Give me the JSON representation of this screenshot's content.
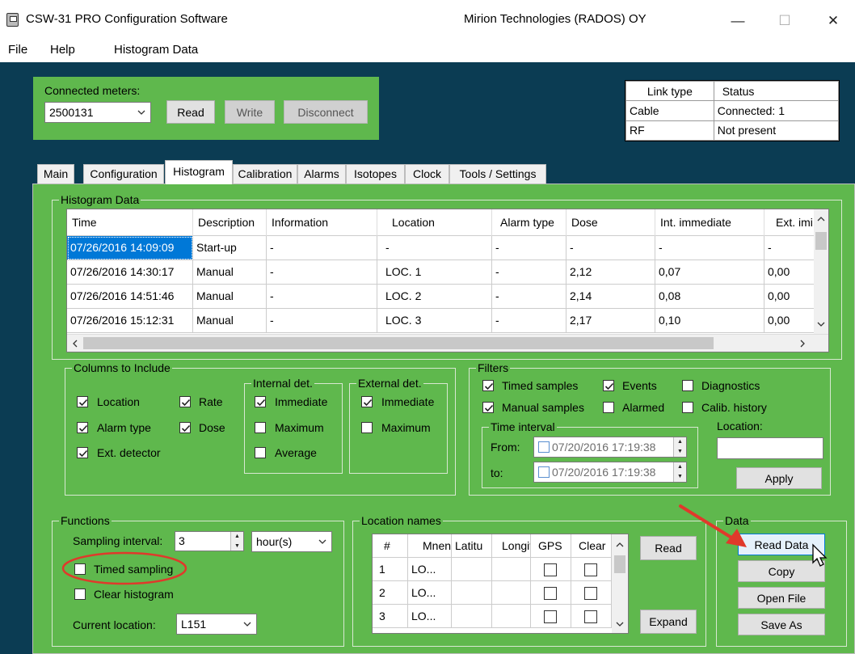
{
  "window": {
    "title": "CSW-31 PRO Configuration Software",
    "company": "Mirion Technologies (RADOS) OY",
    "minimize": "—",
    "maximize": "☐",
    "close": "✕"
  },
  "menu": [
    "File",
    "Help",
    "Histogram Data"
  ],
  "connection": {
    "label": "Connected meters:",
    "selected_meter": "2500131",
    "read": "Read",
    "write": "Write",
    "disconnect": "Disconnect"
  },
  "link_table": {
    "headers": [
      "Link type",
      "Status"
    ],
    "rows": [
      [
        "Cable",
        "Connected: 1"
      ],
      [
        "RF",
        "Not present"
      ]
    ]
  },
  "tabs": [
    "Main",
    "Configuration",
    "Histogram",
    "Calibration",
    "Alarms",
    "Isotopes",
    "Clock",
    "Tools / Settings"
  ],
  "active_tab": "Histogram",
  "histogram": {
    "group_title": "Histogram Data",
    "columns": [
      "Time",
      "Description",
      "Information",
      "Location",
      "Alarm type",
      "Dose",
      "Int. immediate",
      "Ext. imi"
    ],
    "rows": [
      [
        "07/26/2016 14:09:09",
        "Start-up",
        "-",
        "-",
        "-",
        "-",
        "-",
        "-"
      ],
      [
        "07/26/2016 14:30:17",
        "Manual",
        "-",
        "LOC. 1",
        "-",
        "2,12",
        "0,07",
        "0,00"
      ],
      [
        "07/26/2016 14:51:46",
        "Manual",
        "-",
        "LOC. 2",
        "-",
        "2,14",
        "0,08",
        "0,00"
      ],
      [
        "07/26/2016 15:12:31",
        "Manual",
        "-",
        "LOC. 3",
        "-",
        "2,17",
        "0,10",
        "0,00"
      ]
    ]
  },
  "columns_to_include": {
    "title": "Columns to Include",
    "location": "Location",
    "rate": "Rate",
    "alarm_type": "Alarm type",
    "dose": "Dose",
    "ext_detector": "Ext. detector",
    "internal": {
      "title": "Internal det.",
      "immediate": "Immediate",
      "maximum": "Maximum",
      "average": "Average"
    },
    "external": {
      "title": "External det.",
      "immediate": "Immediate",
      "maximum": "Maximum"
    }
  },
  "filters": {
    "title": "Filters",
    "timed_samples": "Timed samples",
    "events": "Events",
    "diagnostics": "Diagnostics",
    "manual_samples": "Manual samples",
    "alarmed": "Alarmed",
    "calib_history": "Calib. history",
    "time_interval": "Time interval",
    "from_label": "From:",
    "to_label": "to:",
    "from_value": "07/20/2016 17:19:38",
    "to_value": "07/20/2016 17:19:38",
    "location_label": "Location:",
    "location_value": "",
    "apply": "Apply"
  },
  "functions": {
    "title": "Functions",
    "sampling_interval_label": "Sampling interval:",
    "sampling_interval_value": "3",
    "sampling_unit": "hour(s)",
    "timed_sampling": "Timed sampling",
    "clear_histogram": "Clear histogram",
    "current_location_label": "Current location:",
    "current_location_value": "L151"
  },
  "location_names": {
    "title": "Location names",
    "columns": [
      "#",
      "Mnen",
      "Latitu",
      "Longit",
      "GPS",
      "Clear"
    ],
    "rows": [
      [
        "1",
        "LO..."
      ],
      [
        "2",
        "LO..."
      ],
      [
        "3",
        "LO..."
      ]
    ],
    "read": "Read",
    "expand": "Expand"
  },
  "data_group": {
    "title": "Data",
    "read_data": "Read Data",
    "copy": "Copy",
    "open_file": "Open File",
    "save_as": "Save As"
  },
  "colors": {
    "background": "#0b3c53",
    "panel_green": "#5fb84d",
    "selection": "#0078d7",
    "annotation_red": "#e0392b"
  }
}
